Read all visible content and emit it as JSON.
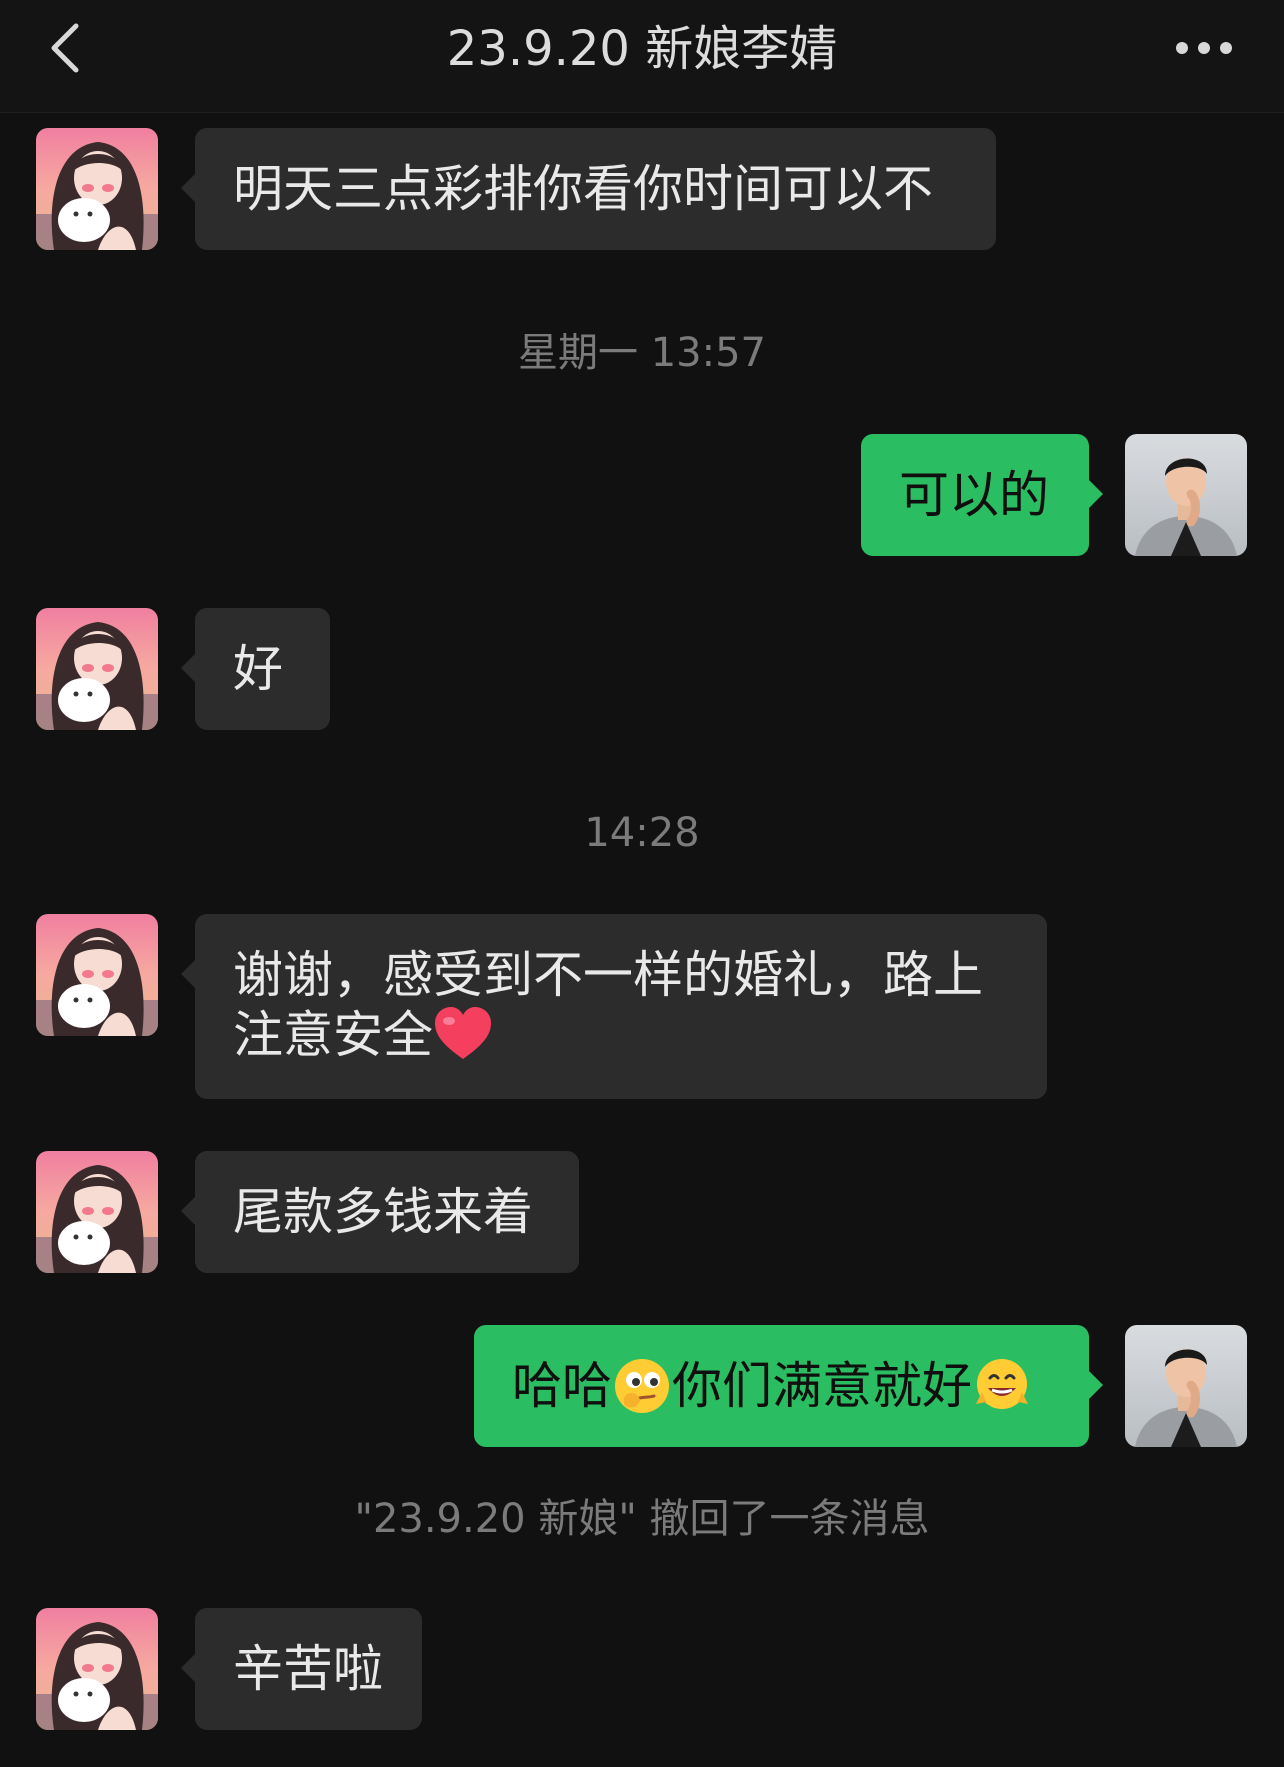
{
  "header": {
    "title": "23.9.20 新娘李婧",
    "back_icon": "chevron-left-icon",
    "more_icon": "more-horizontal-icon"
  },
  "colors": {
    "background": "#111111",
    "incoming_bubble": "#2c2c2c",
    "outgoing_bubble": "#2bbd61",
    "system_text": "#7b7b7b"
  },
  "messages": [
    {
      "from": "bride",
      "text": "明天三点彩排你看你时间可以不"
    },
    {
      "system": "星期一 13:57"
    },
    {
      "from": "me",
      "text": "可以的"
    },
    {
      "from": "bride",
      "text": "好"
    },
    {
      "system": "14:28"
    },
    {
      "from": "bride",
      "text_line1": "谢谢，感受到不一样的婚礼，路上",
      "text_line2": "注意安全",
      "emoji": "heart-emoji"
    },
    {
      "from": "bride",
      "text": "尾款多钱来着"
    },
    {
      "from": "me",
      "text_a": "哈哈",
      "emoji_a": "thinking-face-emoji",
      "text_b": "你们满意就好",
      "emoji_b": "happy-face-emoji"
    },
    {
      "system": "\"23.9.20 新娘\" 撤回了一条消息"
    },
    {
      "from": "bride",
      "text": "辛苦啦"
    }
  ]
}
